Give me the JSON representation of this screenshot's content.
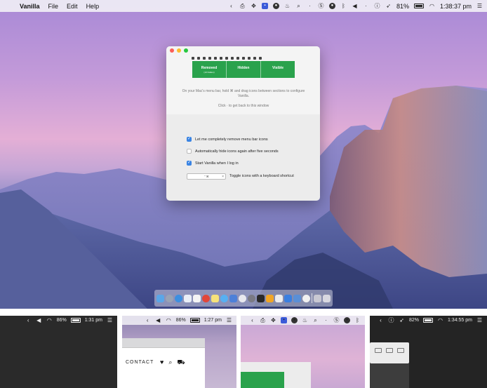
{
  "menubar": {
    "app_name": "Vanilla",
    "menus": [
      "File",
      "Edit",
      "Help"
    ],
    "battery": "81%",
    "time": "1:38:37 pm"
  },
  "window": {
    "sections": [
      {
        "label": "Removed",
        "sub": "(10 hidden)"
      },
      {
        "label": "Hidden",
        "sub": ""
      },
      {
        "label": "Visible",
        "sub": ""
      }
    ],
    "instruction": "On your Mac's menu bar, hold ⌘ and drag icons between sections to configure Vanilla.",
    "back_hint": "Click  ·  to get back to this window",
    "options": [
      {
        "label": "Let me completely remove menu bar icons",
        "checked": true
      },
      {
        "label": "Automatically hide icons again after five seconds",
        "checked": false
      },
      {
        "label": "Start Vanilla when I log in",
        "checked": true
      }
    ],
    "shortcut_value": "⌃⌘",
    "shortcut_clear": "×",
    "shortcut_label": "Toggle icons with a keyboard shortcut"
  },
  "panels": {
    "p1": {
      "battery": "86%",
      "time": "1:31 pm"
    },
    "p2": {
      "battery": "86%",
      "time": "1:27 pm",
      "contact": "CONTACT"
    },
    "p4": {
      "battery": "82%",
      "time": "1:34:55 pm"
    }
  }
}
